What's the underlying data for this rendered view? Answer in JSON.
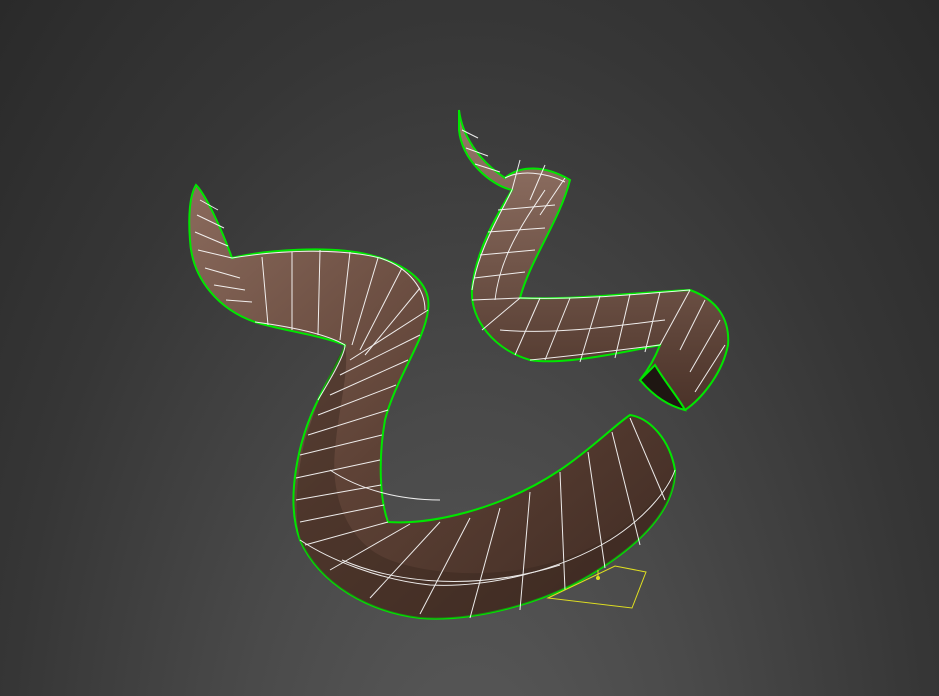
{
  "viewport": {
    "view": "perspective-3d",
    "background_colors": [
      "#2a2a2a",
      "#5a5a5a"
    ]
  },
  "scene": {
    "objects": [
      {
        "name": "tube-left",
        "material_color": "#6b4c3e",
        "wireframe_color": "#ffffff",
        "selection_outline_color": "#00e600",
        "selected": true
      },
      {
        "name": "tube-right",
        "material_color": "#6b4c3e",
        "wireframe_color": "#ffffff",
        "selection_outline_color": "#00e600",
        "selected": true
      }
    ],
    "pivot_gizmo": {
      "color": "#e0e020",
      "icon": "pivot-plane-icon"
    }
  }
}
